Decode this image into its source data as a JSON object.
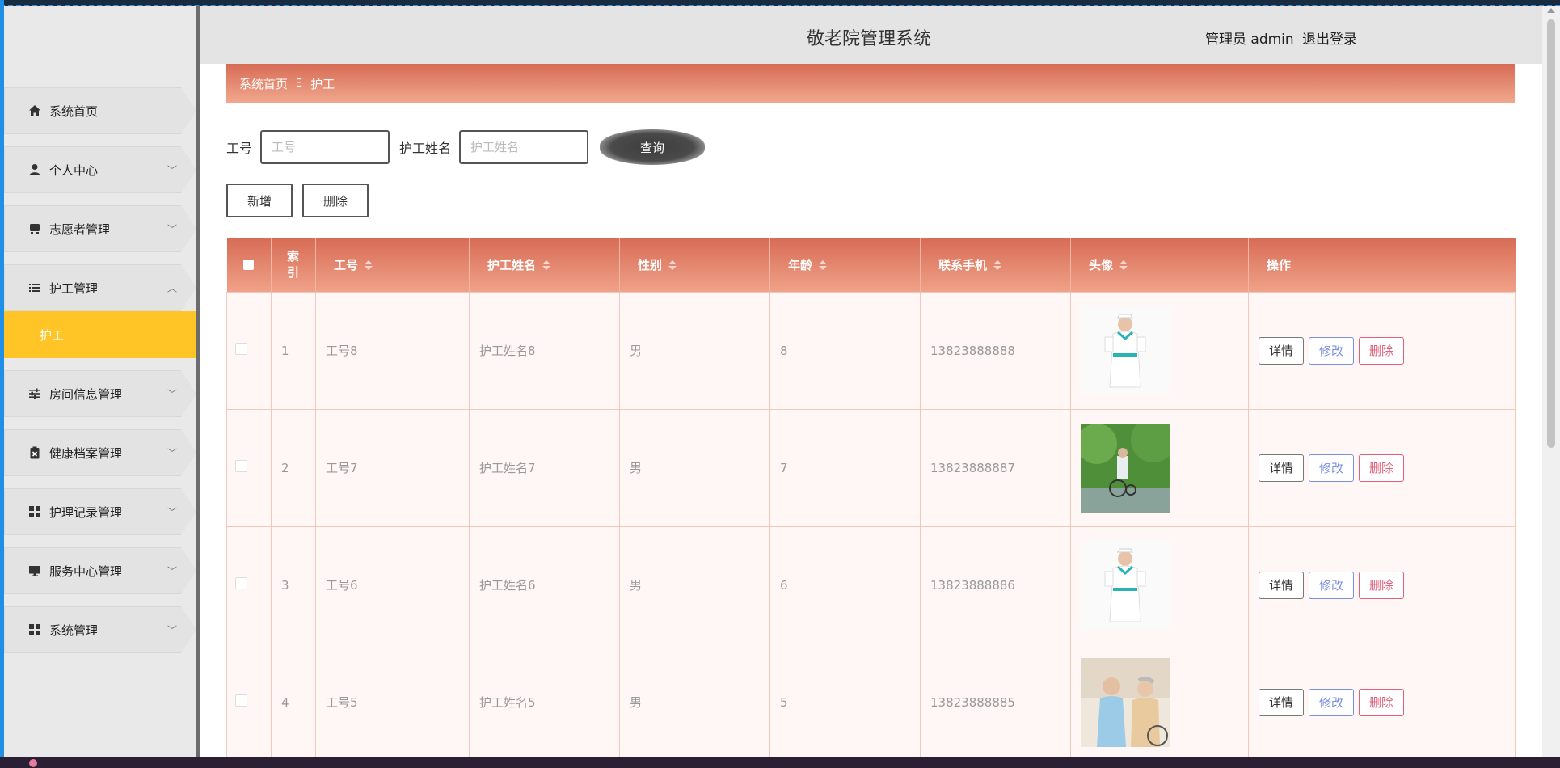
{
  "app": {
    "title": "敬老院管理系统",
    "user_label": "管理员 admin",
    "logout_label": "退出登录"
  },
  "sidebar": {
    "items": [
      {
        "label": "系统首页",
        "icon": "home-icon",
        "has_children": false
      },
      {
        "label": "个人中心",
        "icon": "user-icon",
        "has_children": true
      },
      {
        "label": "志愿者管理",
        "icon": "volunteer-icon",
        "has_children": true
      },
      {
        "label": "护工管理",
        "icon": "list-icon",
        "has_children": true,
        "expanded": true,
        "children": [
          {
            "label": "护工",
            "active": true
          }
        ]
      },
      {
        "label": "房间信息管理",
        "icon": "sliders-icon",
        "has_children": true
      },
      {
        "label": "健康档案管理",
        "icon": "clipboard-icon",
        "has_children": true
      },
      {
        "label": "护理记录管理",
        "icon": "grid-icon",
        "has_children": true
      },
      {
        "label": "服务中心管理",
        "icon": "monitor-icon",
        "has_children": true
      },
      {
        "label": "系统管理",
        "icon": "grid-icon",
        "has_children": true
      }
    ]
  },
  "breadcrumb": {
    "home": "系统首页",
    "separator": "Ξ",
    "current": "护工"
  },
  "search": {
    "fields": [
      {
        "label": "工号",
        "placeholder": "工号",
        "value": ""
      },
      {
        "label": "护工姓名",
        "placeholder": "护工姓名",
        "value": ""
      }
    ],
    "query_label": "查询"
  },
  "actions": {
    "add_label": "新增",
    "delete_label": "删除"
  },
  "table": {
    "columns": [
      "索引",
      "工号",
      "护工姓名",
      "性别",
      "年龄",
      "联系手机",
      "头像",
      "操作"
    ],
    "index_header_lines": [
      "索",
      "引"
    ],
    "rows": [
      {
        "index": "1",
        "id": "工号8",
        "name": "护工姓名8",
        "gender": "男",
        "age": "8",
        "phone": "13823888888",
        "avatar": "nurse-standing"
      },
      {
        "index": "2",
        "id": "工号7",
        "name": "护工姓名7",
        "gender": "男",
        "age": "7",
        "phone": "13823888887",
        "avatar": "wheelchair-park"
      },
      {
        "index": "3",
        "id": "工号6",
        "name": "护工姓名6",
        "gender": "男",
        "age": "6",
        "phone": "13823888886",
        "avatar": "nurse-standing"
      },
      {
        "index": "4",
        "id": "工号5",
        "name": "护工姓名5",
        "gender": "男",
        "age": "5",
        "phone": "13823888885",
        "avatar": "caregiver-elder"
      }
    ],
    "row_actions": {
      "detail": "详情",
      "edit": "修改",
      "delete": "删除"
    }
  },
  "colors": {
    "accent": "#d76b55",
    "active_menu": "#ffc527",
    "edit": "#7b8fe0",
    "danger": "#e0607a"
  }
}
